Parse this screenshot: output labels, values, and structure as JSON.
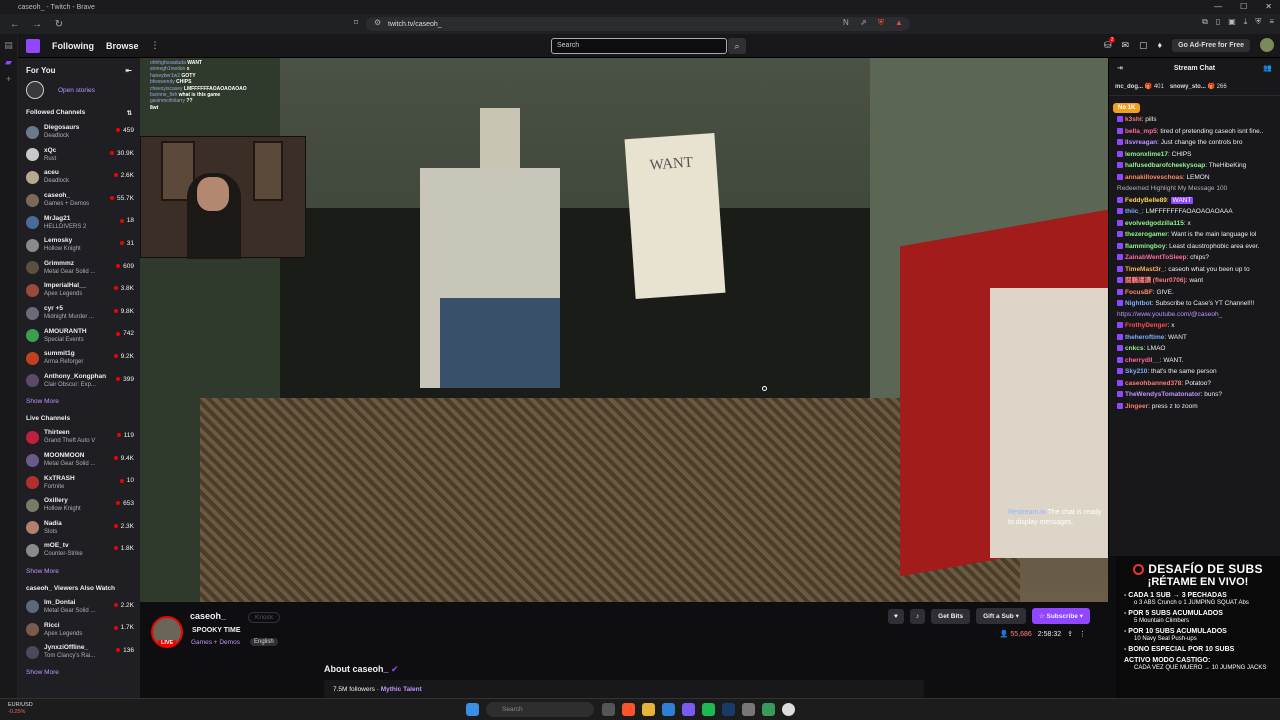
{
  "browser": {
    "title": "caseoh_ - Twitch - Brave",
    "url": "twitch.tv/caseoh_"
  },
  "nav": {
    "following": "Following",
    "browse": "Browse",
    "search_placeholder": "Search",
    "adfree": "Go Ad-Free for Free",
    "notif_count": "2"
  },
  "sidebar": {
    "for_you": "For You",
    "open_stories": "Open stories",
    "followed_title": "Followed Channels",
    "followed": [
      {
        "name": "Diegosaurs",
        "game": "Deadlock",
        "viewers": "459",
        "color": "#6a7a8a"
      },
      {
        "name": "xQc",
        "game": "Rust",
        "viewers": "30.9K",
        "color": "#c9c9c9"
      },
      {
        "name": "aceu",
        "game": "Deadlock",
        "viewers": "2.6K",
        "color": "#b8a890"
      },
      {
        "name": "caseoh_",
        "game": "Games + Demos",
        "viewers": "55.7K",
        "color": "#7a6a5a"
      },
      {
        "name": "MrJag21",
        "game": "HELLDIVERS 2",
        "viewers": "18",
        "color": "#4a6a9a"
      },
      {
        "name": "Lemosky",
        "game": "Hollow Knight",
        "viewers": "31",
        "color": "#8a8a8a"
      },
      {
        "name": "Grimmmz",
        "game": "Metal Gear Solid ...",
        "viewers": "609",
        "color": "#5a5040"
      },
      {
        "name": "ImperialHal__",
        "game": "Apex Legends",
        "viewers": "3.8K",
        "color": "#9a4a3a"
      },
      {
        "name": "cyr +5",
        "game": "Midnight Murder ...",
        "viewers": "9.8K",
        "color": "#6a6a7a"
      },
      {
        "name": "AMOURANTH",
        "game": "Special Events",
        "viewers": "742",
        "color": "#3aa050"
      },
      {
        "name": "summit1g",
        "game": "Arma Reforger",
        "viewers": "9.2K",
        "color": "#c04020"
      },
      {
        "name": "Anthony_Kongphan",
        "game": "Clair Obscur: Exp...",
        "viewers": "399",
        "color": "#5a4a6a"
      }
    ],
    "show_more": "Show More",
    "live_title": "Live Channels",
    "live": [
      {
        "name": "Thirteen",
        "game": "Grand Theft Auto V",
        "viewers": "119",
        "color": "#c02040"
      },
      {
        "name": "MOONMOON",
        "game": "Metal Gear Solid ...",
        "viewers": "9.4K",
        "color": "#6a5a8a"
      },
      {
        "name": "KxTRASH",
        "game": "Fortnite",
        "viewers": "10",
        "color": "#b03030"
      },
      {
        "name": "Oxillery",
        "game": "Hollow Knight",
        "viewers": "653",
        "color": "#7a7a6a"
      },
      {
        "name": "Nadia",
        "game": "Slots",
        "viewers": "2.3K",
        "color": "#b08070"
      },
      {
        "name": "mOE_tv",
        "game": "Counter-Strike",
        "viewers": "1.8K",
        "color": "#8a8a8a"
      }
    ],
    "viewers_title": "caseoh_ Viewers Also Watch",
    "also": [
      {
        "name": "Im_Dontai",
        "game": "Metal Gear Solid ...",
        "viewers": "2.2K",
        "color": "#5a6a7a"
      },
      {
        "name": "Ricci",
        "game": "Apex Legends",
        "viewers": "1.7K",
        "color": "#7a5a4a"
      },
      {
        "name": "JynxziOffline_",
        "game": "Tom Clancy's Rai...",
        "viewers": "136",
        "color": "#4a4a5a"
      }
    ]
  },
  "overlay_chat": [
    {
      "u": "ohhhghosaduda",
      "m": "WANT"
    },
    {
      "u": "stonegh1nwdon",
      "m": "x"
    },
    {
      "u": "haneyber1w2",
      "m": "GOTY"
    },
    {
      "u": "bfwswendy",
      "m": "CHIPS"
    },
    {
      "u": "cheesyiscasey",
      "m": "LMFFFFFFAOAOAOAOAO"
    },
    {
      "u": "bunnne_fish",
      "m": "what is this game"
    },
    {
      "u": "gavinmcrlinlarry",
      "m": "??"
    },
    {
      "u": "",
      "m": "8wt"
    }
  ],
  "video": {
    "sign_text": "WANT",
    "restream_user": "Restream.io",
    "restream_msg": "The chat is ready to display messages."
  },
  "stream": {
    "channel": "caseoh_",
    "knock": "Knock",
    "title": "SPOOKY TIME",
    "game": "Games + Demos",
    "tag": "English",
    "live": "LIVE",
    "get_bits": "Get Bits",
    "gift_sub": "Gift a Sub",
    "subscribe": "Subscribe",
    "viewers": "55,686",
    "uptime": "2:58:32",
    "about": "About caseoh_",
    "followers": "7.5M followers",
    "team": "Mythic Talent"
  },
  "chat": {
    "title": "Stream Chat",
    "gifters": [
      {
        "n": "mc_dog...",
        "c": "401"
      },
      {
        "n": "snowy_sto...",
        "c": "266"
      }
    ],
    "hype": "No 1K",
    "messages": [
      {
        "u": "k3shi",
        "c": "#ff7a7a",
        "m": "pills"
      },
      {
        "u": "bella_mp5",
        "c": "#ff6b9d",
        "m": "tired of pretending caseoh isnt fine.."
      },
      {
        "u": "Ilsvreagan",
        "c": "#bf94ff",
        "m": "Just change the controls bro"
      },
      {
        "u": "lemonxlime17",
        "c": "#8df58d",
        "m": "CHIPS"
      },
      {
        "u": "halfusedbarofcheekysoap",
        "c": "#8df58d",
        "m": "TheHibeKing"
      },
      {
        "u": "annakilloveschoas",
        "c": "#ff8a65",
        "m": "LEMON"
      },
      {
        "u": "",
        "c": "#adadb8",
        "m": "Redeemed Highlight My Message 100",
        "hl": true
      },
      {
        "u": "FeddyBelle89",
        "c": "#ffd54f",
        "m": "WANT",
        "em": true
      },
      {
        "u": "thiic_",
        "c": "#7ab0ff",
        "m": "LMFFFFFFFAOAOAOAOAAA"
      },
      {
        "u": "evolvedgodzilla115",
        "c": "#8df58d",
        "m": "x"
      },
      {
        "u": "thezerogamer",
        "c": "#8df58d",
        "m": "Want is the main language lol"
      },
      {
        "u": "flammingboy",
        "c": "#8df58d",
        "m": "Least claustrophobic area ever."
      },
      {
        "u": "ZainabWentToSleep",
        "c": "#ff6b9d",
        "m": "chips?"
      },
      {
        "u": "TimeMast3r_",
        "c": "#ffb04f",
        "m": "caseoh what you been up to"
      },
      {
        "u": "闘鵬議讀 (fleur0706)",
        "c": "#ff7a7a",
        "m": "want"
      },
      {
        "u": "FocusBF",
        "c": "#ff8a65",
        "m": "GIVE."
      },
      {
        "u": "Nightbot",
        "c": "#7ab0ff",
        "m": "Subscribe to Case's YT Channel!!!",
        "link": "https://www.youtube.com/@caseoh_"
      },
      {
        "u": "FrothyDenger",
        "c": "#ff4f4f",
        "m": "x"
      },
      {
        "u": "theheroftime",
        "c": "#7ab0ff",
        "m": "WANT"
      },
      {
        "u": "cnkcs",
        "c": "#8df58d",
        "m": "LMAO"
      },
      {
        "u": "cherrydll__",
        "c": "#ff6b9d",
        "m": "WANT."
      },
      {
        "u": "Sky210",
        "c": "#7ab0ff",
        "m": "that's the same person"
      },
      {
        "u": "caseohbanned378",
        "c": "#ff7a7a",
        "m": "Potatoo?"
      },
      {
        "u": "TheWendysTomatonator",
        "c": "#bf94ff",
        "m": "buns?"
      },
      {
        "u": "Jingeer",
        "c": "#ff7a7a",
        "m": "press z to zoom"
      }
    ]
  },
  "subs": {
    "title": "DESAFÍO DE SUBS",
    "subtitle": "¡RÉTAME EN VIVO!",
    "items": [
      {
        "l": "- CADA 1 SUB → 3 PECHADAS",
        "s": "o 3 ABS Crunch o 1 JUMPING SQUAT Abs"
      },
      {
        "l": "- POR 5 SUBS ACUMULADOS",
        "s": "5 Mountain Climbers"
      },
      {
        "l": "- POR 10 SUBS ACUMULADOS",
        "s": "10 Navy Seal Push-ups"
      },
      {
        "l": "- BONO ESPECIAL POR 10 SUBS",
        "s": ""
      },
      {
        "l": "ACTIVO MODO CASTIGO:",
        "s": "CADA VEZ QUE MUERO → 10 JUMPNG JACKS"
      }
    ]
  },
  "taskbar": {
    "ticker_pair": "EUR/USD",
    "ticker_change": "-0.25%",
    "search": "Search"
  }
}
